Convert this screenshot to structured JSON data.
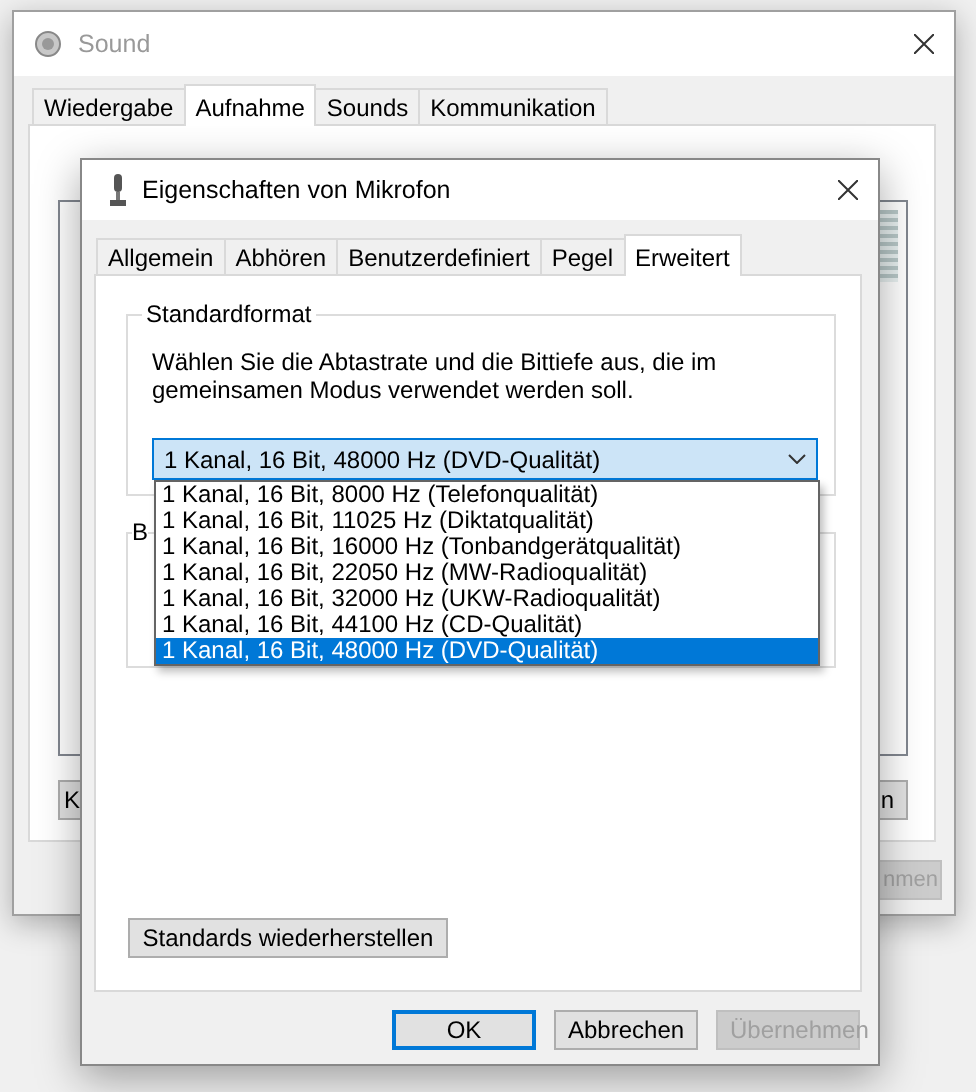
{
  "background_window": {
    "title": "Sound",
    "tabs": [
      {
        "label": "Wiedergabe",
        "selected": false
      },
      {
        "label": "Aufnahme",
        "selected": true
      },
      {
        "label": "Sounds",
        "selected": false
      },
      {
        "label": "Kommunikation",
        "selected": false
      }
    ],
    "buttons": [
      {
        "label": "K",
        "disabled": false
      },
      {
        "label": "n",
        "disabled": false
      }
    ],
    "footer_buttons": [
      {
        "label": "nmen",
        "disabled": true
      }
    ]
  },
  "dialog": {
    "title": "Eigenschaften von Mikrofon",
    "tabs": [
      {
        "label": "Allgemein",
        "selected": false
      },
      {
        "label": "Abhören",
        "selected": false
      },
      {
        "label": "Benutzerdefiniert",
        "selected": false
      },
      {
        "label": "Pegel",
        "selected": false
      },
      {
        "label": "Erweitert",
        "selected": true
      }
    ],
    "format_group": {
      "title": "Standardformat",
      "description": "Wählen Sie die Abtastrate und die Bittiefe aus, die im gemeinsamen Modus verwendet werden soll.",
      "combo": {
        "value": "1 Kanal, 16 Bit, 48000 Hz (DVD-Qualität)",
        "expanded": true
      },
      "options": [
        {
          "label": "1 Kanal, 16 Bit, 8000 Hz (Telefonqualität)",
          "selected": false
        },
        {
          "label": "1 Kanal, 16 Bit, 11025 Hz (Diktatqualität)",
          "selected": false
        },
        {
          "label": "1 Kanal, 16 Bit, 16000 Hz (Tonbandgerätqualität)",
          "selected": false
        },
        {
          "label": "1 Kanal, 16 Bit, 22050 Hz (MW-Radioqualität)",
          "selected": false
        },
        {
          "label": "1 Kanal, 16 Bit, 32000 Hz (UKW-Radioqualität)",
          "selected": false
        },
        {
          "label": "1 Kanal, 16 Bit, 44100 Hz (CD-Qualität)",
          "selected": false
        },
        {
          "label": "1 Kanal, 16 Bit, 48000 Hz (DVD-Qualität)",
          "selected": true
        }
      ]
    },
    "second_group": {
      "title": "B"
    },
    "restore_button": "Standards wiederherstellen",
    "buttons": [
      {
        "label": "OK",
        "default": true,
        "disabled": false
      },
      {
        "label": "Abbrechen",
        "default": false,
        "disabled": false
      },
      {
        "label": "Übernehmen",
        "default": false,
        "disabled": true
      }
    ]
  }
}
